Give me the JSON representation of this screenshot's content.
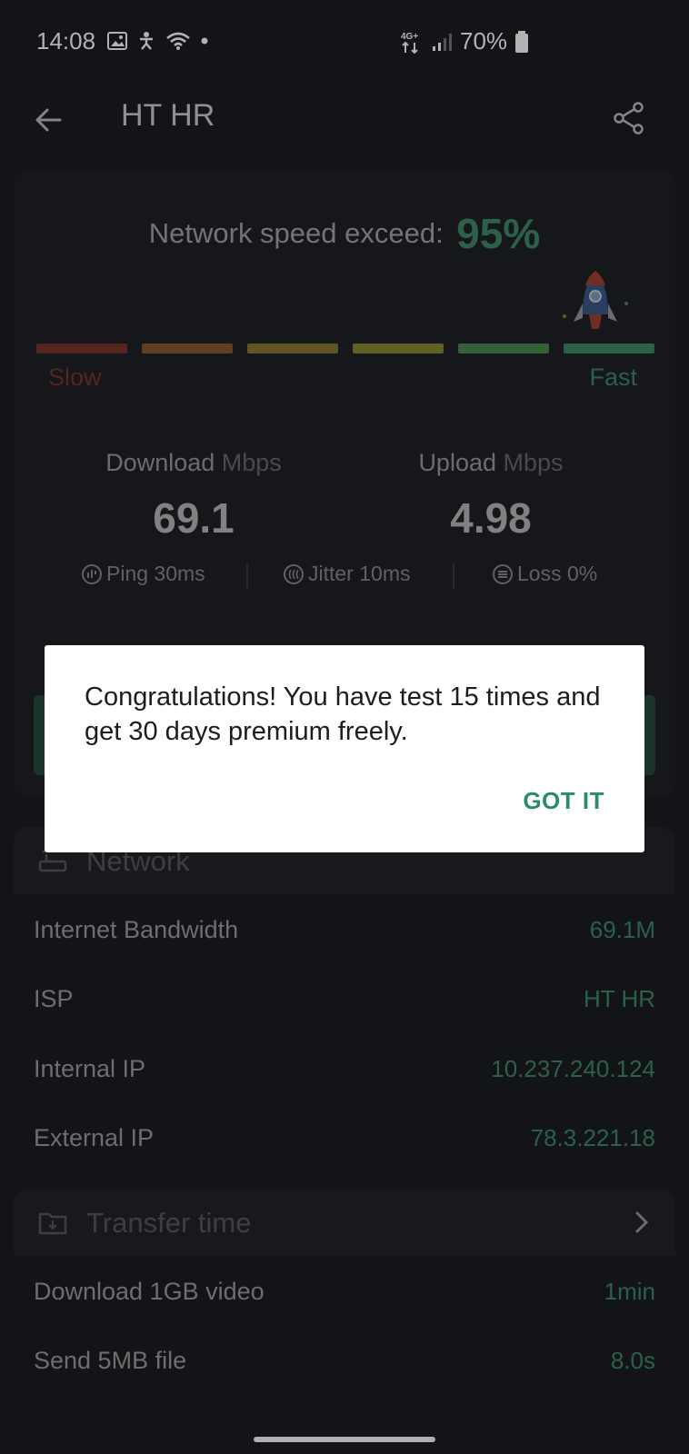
{
  "status_bar": {
    "time": "14:08",
    "network": "4G+",
    "battery": "70%"
  },
  "app_bar": {
    "title": "HT HR"
  },
  "result": {
    "exceed_label": "Network speed exceed:",
    "exceed_value": "95%",
    "slow_label": "Slow",
    "fast_label": "Fast",
    "meter_colors": [
      "#7a3630",
      "#8a5a32",
      "#8a7a35",
      "#8a8a35",
      "#4c8a54",
      "#3f8a6c"
    ],
    "download_label": "Download",
    "upload_label": "Upload",
    "unit": "Mbps",
    "download_value": "69.1",
    "upload_value": "4.98",
    "ping": "Ping 30ms",
    "jitter": "Jitter 10ms",
    "loss": "Loss 0%"
  },
  "network": {
    "title": "Network",
    "rows": [
      {
        "label": "Internet Bandwidth",
        "value": "69.1M"
      },
      {
        "label": "ISP",
        "value": "HT HR"
      },
      {
        "label": "Internal IP",
        "value": "10.237.240.124"
      },
      {
        "label": "External IP",
        "value": "78.3.221.18"
      }
    ]
  },
  "transfer": {
    "title": "Transfer time",
    "rows": [
      {
        "label": "Download 1GB video",
        "value": "1min"
      },
      {
        "label": "Send 5MB file",
        "value": "8.0s"
      }
    ]
  },
  "dialog": {
    "message": "Congratulations! You have test 15 times and get 30 days premium freely.",
    "button": "GOT IT"
  },
  "colors": {
    "accent": "#3f8a6c",
    "background": "#1b1d22"
  }
}
